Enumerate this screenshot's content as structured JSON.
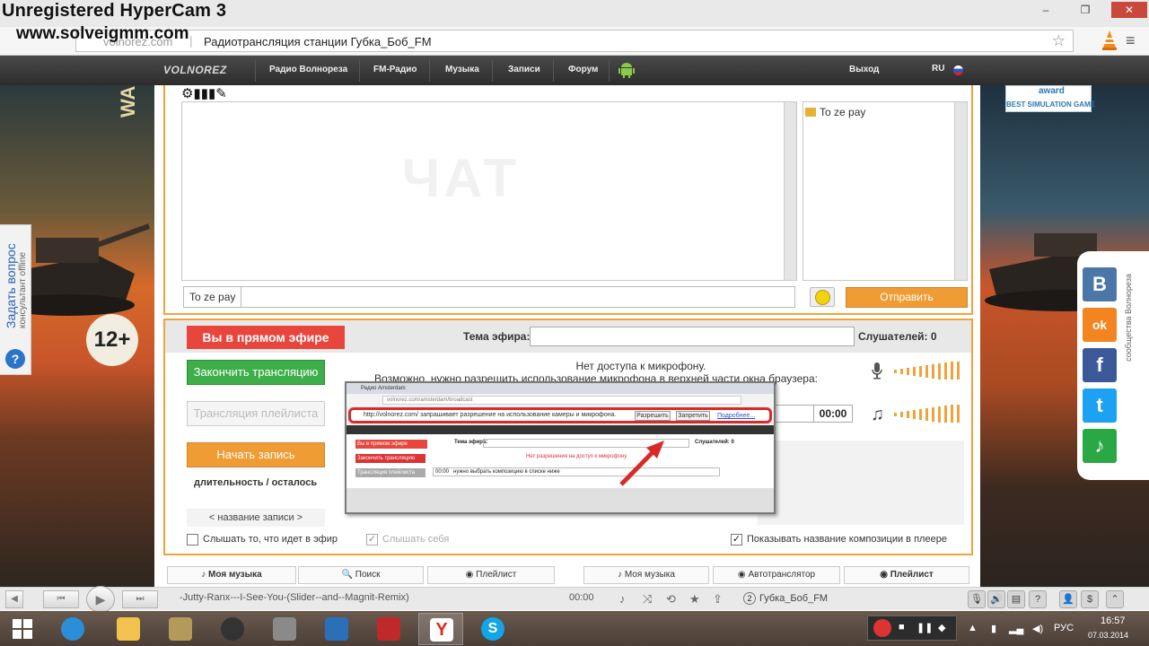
{
  "recorder": {
    "watermark_line1": "Unregistered HyperCam 3",
    "watermark_line2": "www.solveigmm.com"
  },
  "browser": {
    "url_host": "volnorez.com",
    "page_title": "Радиотрансляция станции Губка_Боб_FM",
    "window_controls": [
      "–",
      "❐",
      "✕"
    ]
  },
  "nav": {
    "logo": "VOLNOREZ",
    "items": [
      "Радио Волнореза",
      "FM-Радио",
      "Музыка",
      "Записи",
      "Форум"
    ],
    "logout": "Выход",
    "lang": "RU"
  },
  "left_banner": {
    "age": "12+",
    "game_text": "WA",
    "ask_question": "Задать вопрос",
    "consultant_status": "консультант offline"
  },
  "right_banner": {
    "award": "award",
    "award_sub": "BEST SIMULATION GAME",
    "social_caption": "сообщества Волнореза",
    "social": [
      {
        "name": "vk",
        "glyph": "В",
        "color": "#4a76a8"
      },
      {
        "name": "odnoklassniki",
        "glyph": "ok",
        "color": "#f48420"
      },
      {
        "name": "facebook",
        "glyph": "f",
        "color": "#3b5998"
      },
      {
        "name": "twitter",
        "glyph": "t",
        "color": "#1da1f2"
      },
      {
        "name": "other",
        "glyph": "♪",
        "color": "#2aa845"
      }
    ]
  },
  "chat": {
    "watermark": "ЧАТ",
    "users": [
      "To ze pay"
    ],
    "nickname": "To ze pay",
    "input_value": "",
    "send_label": "Отправить"
  },
  "broadcast": {
    "live_badge": "Вы в прямом эфире",
    "topic_label": "Тема эфира:",
    "topic_value": "",
    "listeners": "Слушателей: 0",
    "stop_button": "Закончить трансляцию",
    "playlist_button": "Трансляция плейлиста",
    "record_button": "Начать запись",
    "duration_label": "длительность / осталось",
    "record_name": "< название записи >",
    "mic_message_1": "Нет доступа к микрофону.",
    "mic_message_2": "Возможно, нужно разрешить использование микрофона в верхней части окна браузера:",
    "track_time": "00:00",
    "checkboxes": [
      {
        "label": "Слышать то, что идет в эфир",
        "checked": false
      },
      {
        "label": "Слышать себя",
        "checked": true
      },
      {
        "label": "Показывать название композиции в плеере",
        "checked": true
      }
    ]
  },
  "inset": {
    "title": "Радио Amsterdam",
    "url": "volnorez.com/amsterdam/broadcast",
    "prompt": "http://volnorez.com/ запрашивает разрешение на использование камеры и микрофона.",
    "allow": "Разрешить",
    "deny": "Запретить",
    "more": "Подробнее...",
    "live": "Вы в прямом эфире",
    "topic": "Тема эфира:",
    "listeners": "Слушателей: 0",
    "stop": "Закончить трансляцию",
    "mic_msg": "Нет разрешения на доступ к микрофону",
    "playlist": "Трансляция плейлиста",
    "track": "нужно выбрать композицию в списке ниже",
    "time": "00:00"
  },
  "tabs": [
    {
      "label": "Моя музыка",
      "icon": "♪"
    },
    {
      "label": "Поиск",
      "icon": "🔍"
    },
    {
      "label": "Плейлист",
      "icon": "◉"
    },
    {
      "label": "Моя музыка",
      "icon": "♪"
    },
    {
      "label": "Автотранслятор",
      "icon": "◉"
    },
    {
      "label": "Плейлист",
      "icon": "◉"
    }
  ],
  "player": {
    "prev": "⏮",
    "play": "▶",
    "next": "⏭",
    "track": "-Jutty-Ranx---I-See-You-(Slider--and--Magnit-Remix)",
    "time": "00:00",
    "station_num": "2",
    "station": "Губка_Боб_FM"
  },
  "taskbar": {
    "lang": "РУС",
    "time": "16:57",
    "date": "07.03.2014"
  }
}
